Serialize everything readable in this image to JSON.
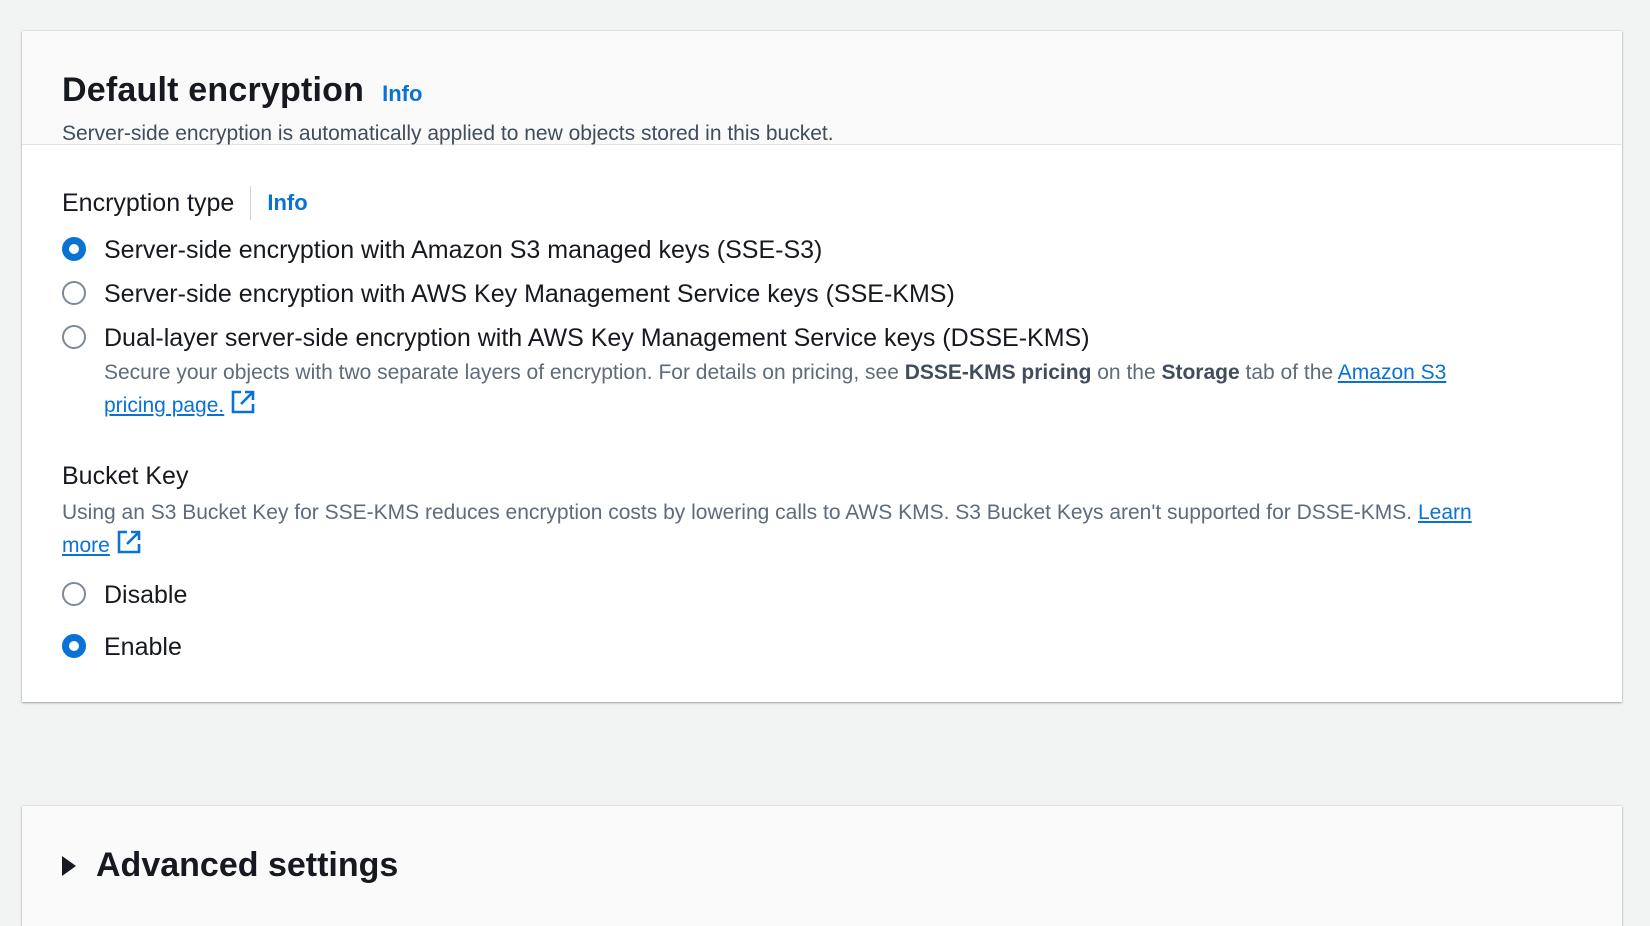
{
  "default_encryption": {
    "title": "Default encryption",
    "info": "Info",
    "description": "Server-side encryption is automatically applied to new objects stored in this bucket."
  },
  "encryption_type": {
    "label": "Encryption type",
    "info": "Info",
    "options": [
      {
        "label": "Server-side encryption with Amazon S3 managed keys (SSE-S3)",
        "checked": true
      },
      {
        "label": "Server-side encryption with AWS Key Management Service keys (SSE-KMS)",
        "checked": false
      },
      {
        "label": "Dual-layer server-side encryption with AWS Key Management Service keys (DSSE-KMS)",
        "checked": false,
        "desc_part1": "Secure your objects with two separate layers of encryption. For details on pricing, see ",
        "desc_bold1": "DSSE-KMS pricing",
        "desc_part2": " on the ",
        "desc_bold2": "Storage",
        "desc_part3": " tab of the ",
        "desc_link": "Amazon S3 pricing page."
      }
    ]
  },
  "bucket_key": {
    "label": "Bucket Key",
    "help": "Using an S3 Bucket Key for SSE-KMS reduces encryption costs by lowering calls to AWS KMS. S3 Bucket Keys aren't supported for DSSE-KMS. ",
    "learn_more": "Learn more",
    "options": [
      {
        "label": "Disable",
        "checked": false
      },
      {
        "label": "Enable",
        "checked": true
      }
    ]
  },
  "advanced_settings": {
    "title": "Advanced settings"
  },
  "colors": {
    "accent": "#0972d3",
    "text": "#16191f",
    "secondary_text": "#5f6b7a"
  }
}
